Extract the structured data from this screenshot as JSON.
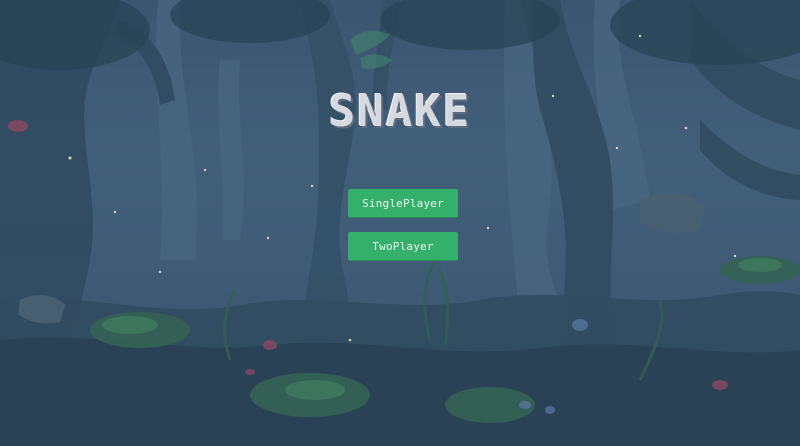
{
  "game": {
    "title": "SNAKE"
  },
  "menu": {
    "single_player_label": "SinglePlayer",
    "two_player_label": "TwoPlayer"
  },
  "colors": {
    "button_bg": "#35b06a",
    "button_text": "#eaf7ee",
    "title_text": "#d6d9e0"
  }
}
